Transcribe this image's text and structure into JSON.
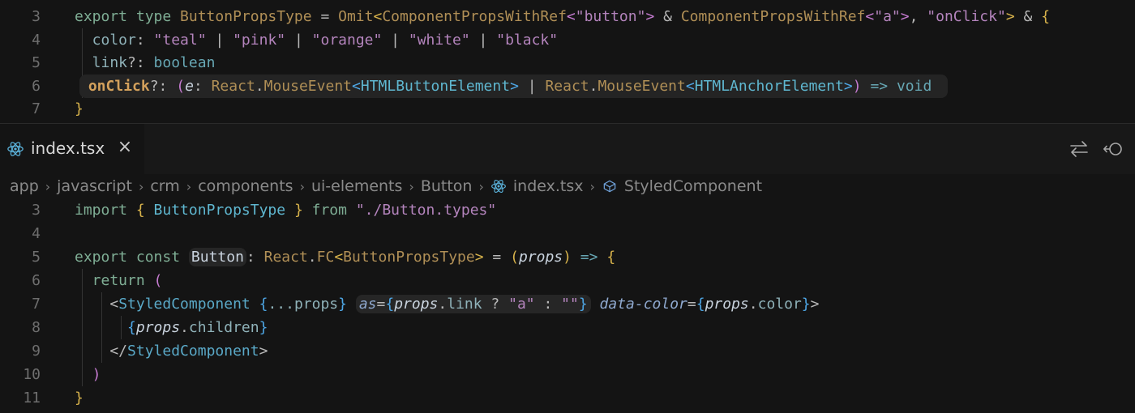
{
  "top_pane": {
    "lines": [
      {
        "num": "3",
        "tokens": [
          {
            "t": "export ",
            "c": "kw"
          },
          {
            "t": "type ",
            "c": "kw"
          },
          {
            "t": "ButtonPropsType",
            "c": "ty"
          },
          {
            "t": " = ",
            "c": "op"
          },
          {
            "t": "Omit",
            "c": "ty"
          },
          {
            "t": "<",
            "c": "br1"
          },
          {
            "t": "ComponentPropsWithRef",
            "c": "ty"
          },
          {
            "t": "<",
            "c": "br2"
          },
          {
            "t": "\"button\"",
            "c": "str"
          },
          {
            "t": ">",
            "c": "br2"
          },
          {
            "t": " & ",
            "c": "op"
          },
          {
            "t": "ComponentPropsWithRef",
            "c": "ty"
          },
          {
            "t": "<",
            "c": "br2"
          },
          {
            "t": "\"a\"",
            "c": "str"
          },
          {
            "t": ">",
            "c": "br2"
          },
          {
            "t": ", ",
            "c": "pn"
          },
          {
            "t": "\"onClick\"",
            "c": "str"
          },
          {
            "t": ">",
            "c": "br1"
          },
          {
            "t": " & ",
            "c": "op"
          },
          {
            "t": "{",
            "c": "br1"
          }
        ]
      },
      {
        "num": "4",
        "tokens": [
          {
            "t": "  color",
            "c": "pr"
          },
          {
            "t": ": ",
            "c": "pn"
          },
          {
            "t": "\"teal\"",
            "c": "str"
          },
          {
            "t": " | ",
            "c": "op"
          },
          {
            "t": "\"pink\"",
            "c": "str"
          },
          {
            "t": " | ",
            "c": "op"
          },
          {
            "t": "\"orange\"",
            "c": "str"
          },
          {
            "t": " | ",
            "c": "op"
          },
          {
            "t": "\"white\"",
            "c": "str"
          },
          {
            "t": " | ",
            "c": "op"
          },
          {
            "t": "\"black\"",
            "c": "str"
          }
        ]
      },
      {
        "num": "5",
        "tokens": [
          {
            "t": "  link",
            "c": "pr"
          },
          {
            "t": "?: ",
            "c": "pn"
          },
          {
            "t": "boolean",
            "c": "kw2"
          }
        ]
      },
      {
        "num": "6",
        "highlight": true,
        "tokens": [
          {
            "t": "  ",
            "c": "pn"
          },
          {
            "t": "onClick",
            "c": "fn bold"
          },
          {
            "t": "?: ",
            "c": "pn"
          },
          {
            "t": "(",
            "c": "br2"
          },
          {
            "t": "e",
            "c": "var ital"
          },
          {
            "t": ": ",
            "c": "pn"
          },
          {
            "t": "React",
            "c": "ty"
          },
          {
            "t": ".",
            "c": "pn"
          },
          {
            "t": "MouseEvent",
            "c": "ty"
          },
          {
            "t": "<",
            "c": "br3"
          },
          {
            "t": "HTMLButtonElement",
            "c": "tp"
          },
          {
            "t": ">",
            "c": "br3"
          },
          {
            "t": " | ",
            "c": "op"
          },
          {
            "t": "React",
            "c": "ty"
          },
          {
            "t": ".",
            "c": "pn"
          },
          {
            "t": "MouseEvent",
            "c": "ty"
          },
          {
            "t": "<",
            "c": "br3"
          },
          {
            "t": "HTMLAnchorElement",
            "c": "tp"
          },
          {
            "t": ">",
            "c": "br3"
          },
          {
            "t": ")",
            "c": "br2"
          },
          {
            "t": " => ",
            "c": "kw2"
          },
          {
            "t": "void",
            "c": "kw2"
          }
        ]
      },
      {
        "num": "7",
        "tokens": [
          {
            "t": "}",
            "c": "br1"
          }
        ]
      }
    ]
  },
  "tab": {
    "label": "index.tsx",
    "close": "×"
  },
  "breadcrumb": [
    "app",
    "javascript",
    "crm",
    "components",
    "ui-elements",
    "Button",
    "index.tsx",
    "StyledComponent"
  ],
  "bottom_pane": {
    "lines": [
      {
        "num": "3",
        "tokens": [
          {
            "t": "import ",
            "c": "kw"
          },
          {
            "t": "{ ",
            "c": "br1"
          },
          {
            "t": "ButtonPropsType",
            "c": "tp"
          },
          {
            "t": " }",
            "c": "br1"
          },
          {
            "t": " from ",
            "c": "kw"
          },
          {
            "t": "\"./Button.types\"",
            "c": "str"
          }
        ]
      },
      {
        "num": "4",
        "tokens": []
      },
      {
        "num": "5",
        "tokens": [
          {
            "t": "export ",
            "c": "kw"
          },
          {
            "t": "const ",
            "c": "kw"
          },
          {
            "t": "Button",
            "c": "var hlbox"
          },
          {
            "t": ": ",
            "c": "pn"
          },
          {
            "t": "React",
            "c": "ty"
          },
          {
            "t": ".",
            "c": "pn"
          },
          {
            "t": "FC",
            "c": "ty"
          },
          {
            "t": "<",
            "c": "br1"
          },
          {
            "t": "ButtonPropsType",
            "c": "ty"
          },
          {
            "t": ">",
            "c": "br1"
          },
          {
            "t": " = ",
            "c": "op"
          },
          {
            "t": "(",
            "c": "br1"
          },
          {
            "t": "props",
            "c": "var ital"
          },
          {
            "t": ")",
            "c": "br1"
          },
          {
            "t": " => ",
            "c": "kw2"
          },
          {
            "t": "{",
            "c": "br1"
          }
        ]
      },
      {
        "num": "6",
        "tokens": [
          {
            "t": "  return ",
            "c": "kw"
          },
          {
            "t": "(",
            "c": "br2"
          }
        ]
      },
      {
        "num": "7",
        "tokens": [
          {
            "t": "    <",
            "c": "pn"
          },
          {
            "t": "StyledComponent",
            "c": "tag"
          },
          {
            "t": " {",
            "c": "br3"
          },
          {
            "t": "...props",
            "c": "pr"
          },
          {
            "t": "}",
            "c": "br3"
          },
          {
            "t": " ",
            "c": "pn"
          },
          {
            "t": "as",
            "c": "attr ital hlstart"
          },
          {
            "t": "=",
            "c": "op"
          },
          {
            "t": "{",
            "c": "br3"
          },
          {
            "t": "props",
            "c": "var ital"
          },
          {
            "t": ".",
            "c": "pn"
          },
          {
            "t": "link",
            "c": "pr"
          },
          {
            "t": " ? ",
            "c": "op"
          },
          {
            "t": "\"a\"",
            "c": "str"
          },
          {
            "t": " : ",
            "c": "op"
          },
          {
            "t": "\"\"",
            "c": "str"
          },
          {
            "t": "}",
            "c": "br3 hlend"
          },
          {
            "t": " data-color",
            "c": "attr ital"
          },
          {
            "t": "=",
            "c": "op"
          },
          {
            "t": "{",
            "c": "br3"
          },
          {
            "t": "props",
            "c": "var ital"
          },
          {
            "t": ".",
            "c": "pn"
          },
          {
            "t": "color",
            "c": "pr"
          },
          {
            "t": "}",
            "c": "br3"
          },
          {
            "t": ">",
            "c": "pn"
          }
        ]
      },
      {
        "num": "8",
        "tokens": [
          {
            "t": "      {",
            "c": "br3"
          },
          {
            "t": "props",
            "c": "var ital"
          },
          {
            "t": ".",
            "c": "pn"
          },
          {
            "t": "children",
            "c": "pr"
          },
          {
            "t": "}",
            "c": "br3"
          }
        ]
      },
      {
        "num": "9",
        "tokens": [
          {
            "t": "    </",
            "c": "pn"
          },
          {
            "t": "StyledComponent",
            "c": "tag"
          },
          {
            "t": ">",
            "c": "pn"
          }
        ]
      },
      {
        "num": "10",
        "tokens": [
          {
            "t": "  )",
            "c": "br2"
          }
        ]
      },
      {
        "num": "11",
        "tokens": [
          {
            "t": "}",
            "c": "br1"
          }
        ]
      }
    ]
  },
  "icons": {
    "react": "react-icon",
    "close": "close-icon",
    "compare": "compare-changes-icon",
    "revert": "revert-icon",
    "symbol": "symbol-field-icon"
  },
  "colors": {
    "background": "#141414",
    "tab_bar": "#181818",
    "react_icon": "#5ab0d8"
  }
}
